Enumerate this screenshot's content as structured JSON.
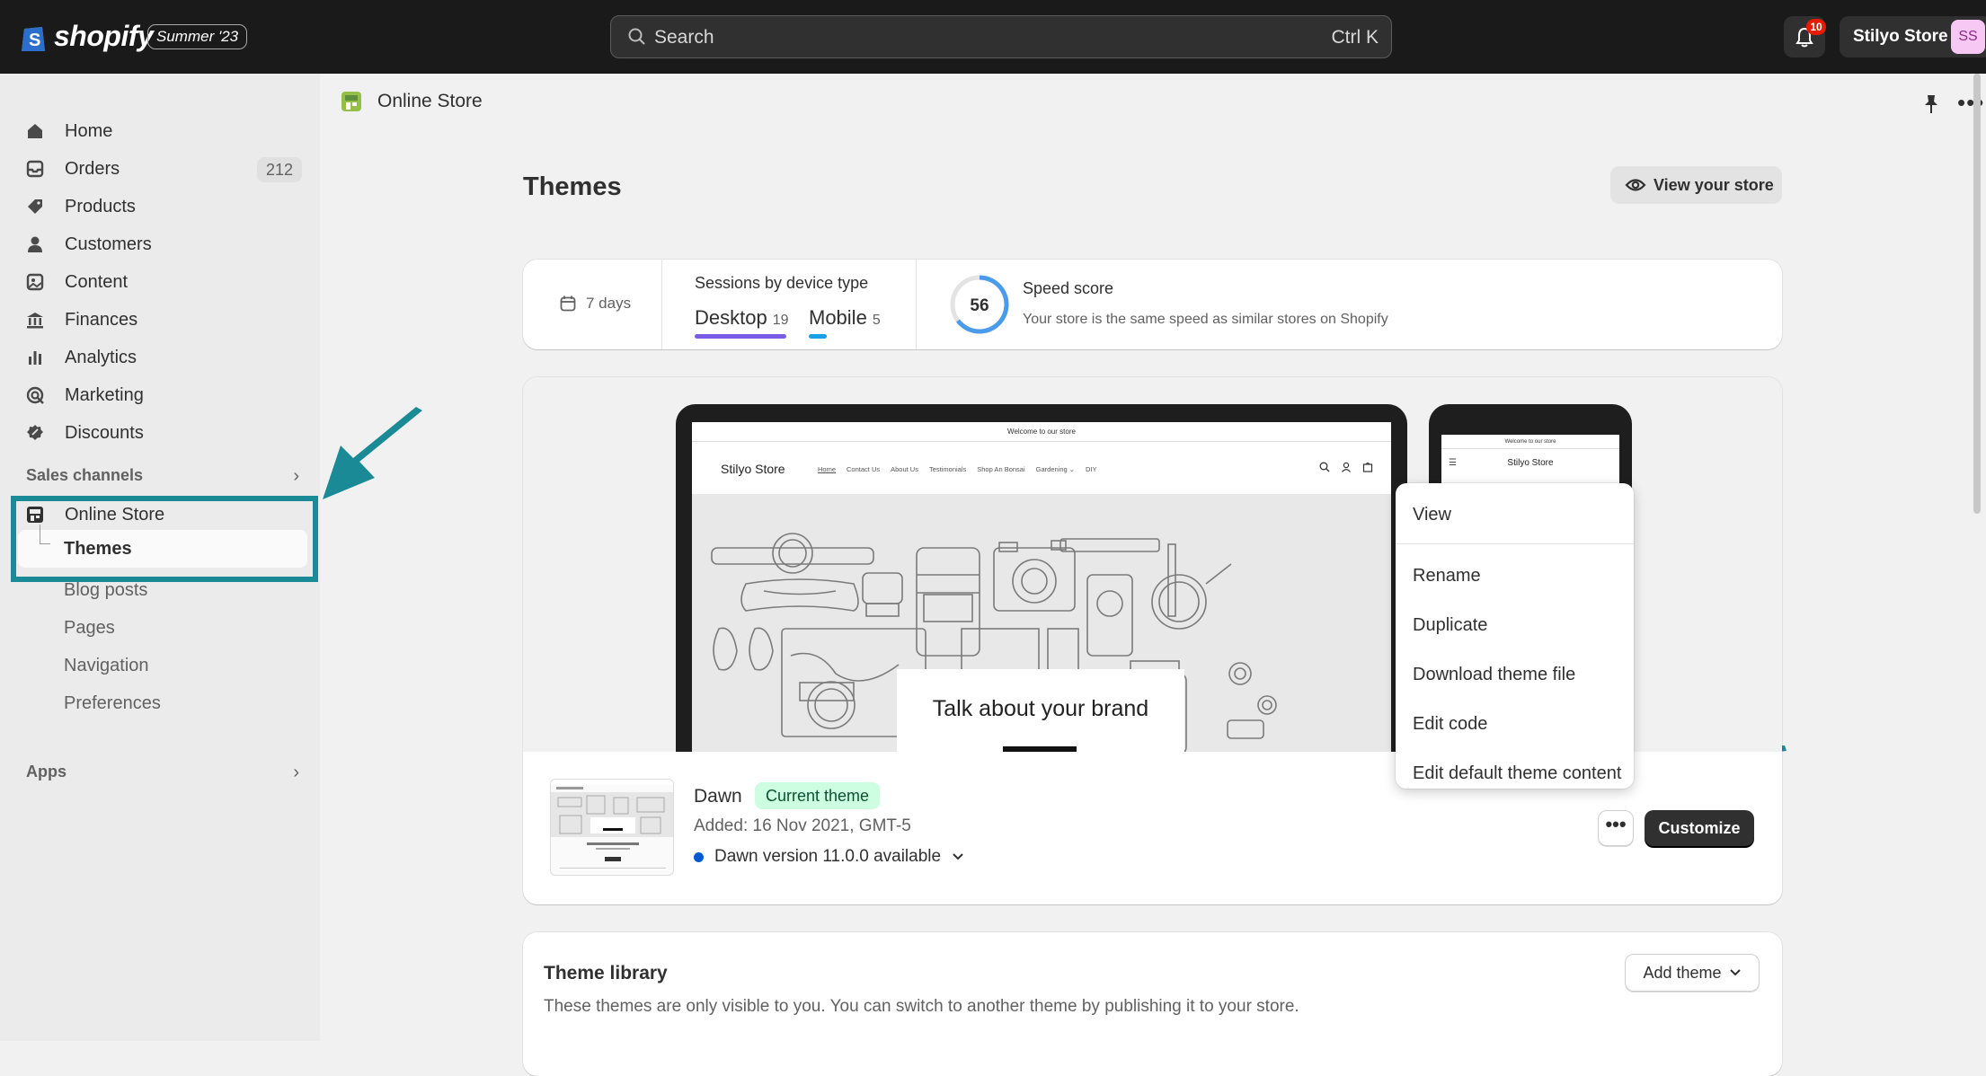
{
  "topbar": {
    "brand": "shopify",
    "edition_badge": "Summer '23",
    "search_placeholder": "Search",
    "search_shortcut": "Ctrl K",
    "notification_count": "10",
    "store_name": "Stilyo Store",
    "avatar_initials": "SS"
  },
  "sidebar": {
    "items": [
      {
        "label": "Home",
        "icon": "home-icon"
      },
      {
        "label": "Orders",
        "icon": "orders-icon",
        "count": "212"
      },
      {
        "label": "Products",
        "icon": "tag-icon"
      },
      {
        "label": "Customers",
        "icon": "person-icon"
      },
      {
        "label": "Content",
        "icon": "image-icon"
      },
      {
        "label": "Finances",
        "icon": "bank-icon"
      },
      {
        "label": "Analytics",
        "icon": "bar-chart-icon"
      },
      {
        "label": "Marketing",
        "icon": "target-icon"
      },
      {
        "label": "Discounts",
        "icon": "discount-icon"
      }
    ],
    "sales_channels_heading": "Sales channels",
    "online_store": "Online Store",
    "sub_items": {
      "themes": "Themes",
      "blog_posts": "Blog posts",
      "pages": "Pages",
      "navigation": "Navigation",
      "preferences": "Preferences"
    },
    "apps_heading": "Apps"
  },
  "header": {
    "breadcrumb": "Online Store",
    "page_title": "Themes",
    "view_store_label": "View your store"
  },
  "stats": {
    "period": "7 days",
    "sessions_title": "Sessions by device type",
    "desktop_label": "Desktop",
    "desktop_count": "19",
    "mobile_label": "Mobile",
    "mobile_count": "5",
    "speed_score": "56",
    "speed_title": "Speed score",
    "speed_subtitle": "Your store is the same speed as similar stores on Shopify"
  },
  "preview": {
    "announcement": "Welcome to our store",
    "store_name": "Stilyo Store",
    "nav": [
      "Home",
      "Contact Us",
      "About Us",
      "Testimonials",
      "Shop An Bonsai",
      "Gardening ⌄",
      "DIY"
    ],
    "hero_text": "Talk about your brand"
  },
  "theme": {
    "name": "Dawn",
    "badge": "Current theme",
    "added": "Added: 16 Nov 2021, GMT-5",
    "version": "Dawn version 11.0.0 available",
    "more_button": "•••",
    "customize_label": "Customize"
  },
  "menu": {
    "items": [
      "View",
      "Rename",
      "Duplicate",
      "Download theme file",
      "Edit code",
      "Edit default theme content"
    ]
  },
  "library": {
    "title": "Theme library",
    "subtitle": "These themes are only visible to you. You can switch to another theme by publishing it to your store.",
    "add_theme_label": "Add theme"
  },
  "colors": {
    "topbar": "#1a1a1a",
    "annotation": "#1a8a96",
    "badge_green": "#cdfee1",
    "desktop_underline": "#7b5ce6",
    "mobile_underline": "#1aa0e6"
  }
}
